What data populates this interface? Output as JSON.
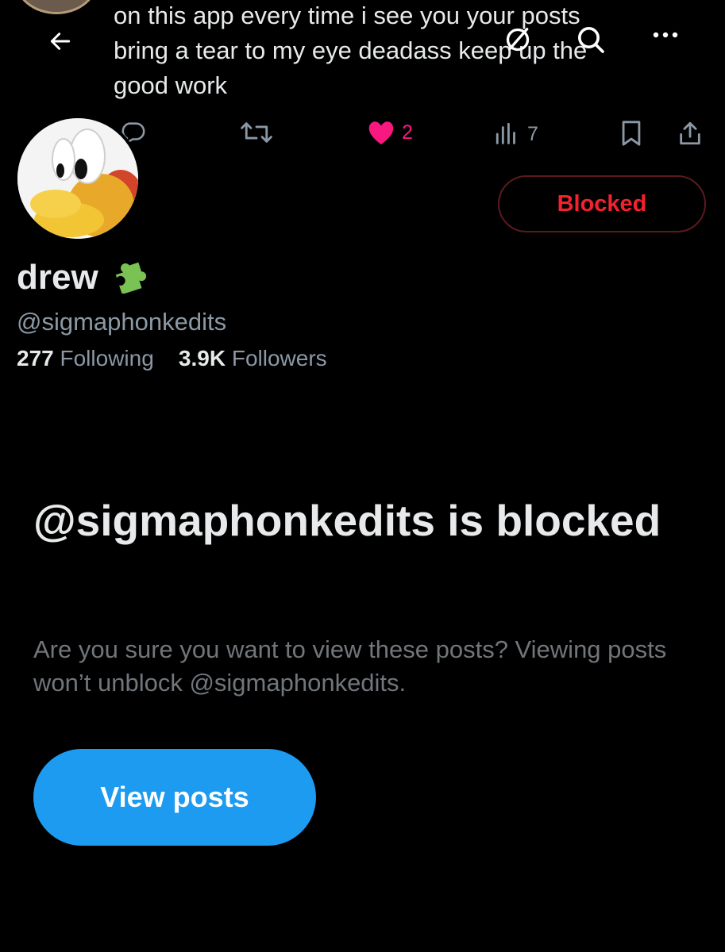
{
  "tweet": {
    "line1": "on this app every time i see you your posts",
    "line2": "bring a tear to my eye deadass keep up the",
    "line3": "good work",
    "likes": "2",
    "views": "7"
  },
  "profile": {
    "name": "drew",
    "handle": "@sigmaphonkedits",
    "following_count": "277",
    "following_label": "Following",
    "followers_count": "3.9K",
    "followers_label": "Followers",
    "blocked_button": "Blocked"
  },
  "blocked_notice": {
    "title": "@sigmaphonkedits is blocked",
    "description": "Are you sure you want to view these posts? Viewing posts won’t unblock @sigmaphonkedits.",
    "view_button": "View posts"
  },
  "icons": {
    "back": "arrow-left-icon",
    "shield": "no-sign-icon",
    "search": "search-icon",
    "more": "more-icon",
    "reply": "reply-icon",
    "retweet": "retweet-icon",
    "like": "heart-icon",
    "views": "views-icon",
    "bookmark": "bookmark-icon",
    "share": "share-icon"
  },
  "colors": {
    "accent": "#1d9bf0",
    "like": "#f91880",
    "blocked": "#f4212e"
  }
}
